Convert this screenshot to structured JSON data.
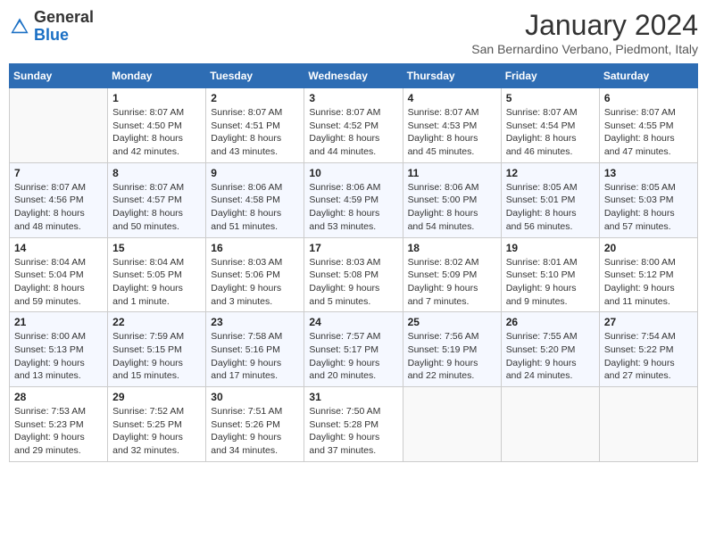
{
  "header": {
    "logo_general": "General",
    "logo_blue": "Blue",
    "title": "January 2024",
    "subtitle": "San Bernardino Verbano, Piedmont, Italy"
  },
  "weekdays": [
    "Sunday",
    "Monday",
    "Tuesday",
    "Wednesday",
    "Thursday",
    "Friday",
    "Saturday"
  ],
  "weeks": [
    [
      {
        "day": "",
        "sunrise": "",
        "sunset": "",
        "daylight": ""
      },
      {
        "day": "1",
        "sunrise": "Sunrise: 8:07 AM",
        "sunset": "Sunset: 4:50 PM",
        "daylight": "Daylight: 8 hours and 42 minutes."
      },
      {
        "day": "2",
        "sunrise": "Sunrise: 8:07 AM",
        "sunset": "Sunset: 4:51 PM",
        "daylight": "Daylight: 8 hours and 43 minutes."
      },
      {
        "day": "3",
        "sunrise": "Sunrise: 8:07 AM",
        "sunset": "Sunset: 4:52 PM",
        "daylight": "Daylight: 8 hours and 44 minutes."
      },
      {
        "day": "4",
        "sunrise": "Sunrise: 8:07 AM",
        "sunset": "Sunset: 4:53 PM",
        "daylight": "Daylight: 8 hours and 45 minutes."
      },
      {
        "day": "5",
        "sunrise": "Sunrise: 8:07 AM",
        "sunset": "Sunset: 4:54 PM",
        "daylight": "Daylight: 8 hours and 46 minutes."
      },
      {
        "day": "6",
        "sunrise": "Sunrise: 8:07 AM",
        "sunset": "Sunset: 4:55 PM",
        "daylight": "Daylight: 8 hours and 47 minutes."
      }
    ],
    [
      {
        "day": "7",
        "sunrise": "Sunrise: 8:07 AM",
        "sunset": "Sunset: 4:56 PM",
        "daylight": "Daylight: 8 hours and 48 minutes."
      },
      {
        "day": "8",
        "sunrise": "Sunrise: 8:07 AM",
        "sunset": "Sunset: 4:57 PM",
        "daylight": "Daylight: 8 hours and 50 minutes."
      },
      {
        "day": "9",
        "sunrise": "Sunrise: 8:06 AM",
        "sunset": "Sunset: 4:58 PM",
        "daylight": "Daylight: 8 hours and 51 minutes."
      },
      {
        "day": "10",
        "sunrise": "Sunrise: 8:06 AM",
        "sunset": "Sunset: 4:59 PM",
        "daylight": "Daylight: 8 hours and 53 minutes."
      },
      {
        "day": "11",
        "sunrise": "Sunrise: 8:06 AM",
        "sunset": "Sunset: 5:00 PM",
        "daylight": "Daylight: 8 hours and 54 minutes."
      },
      {
        "day": "12",
        "sunrise": "Sunrise: 8:05 AM",
        "sunset": "Sunset: 5:01 PM",
        "daylight": "Daylight: 8 hours and 56 minutes."
      },
      {
        "day": "13",
        "sunrise": "Sunrise: 8:05 AM",
        "sunset": "Sunset: 5:03 PM",
        "daylight": "Daylight: 8 hours and 57 minutes."
      }
    ],
    [
      {
        "day": "14",
        "sunrise": "Sunrise: 8:04 AM",
        "sunset": "Sunset: 5:04 PM",
        "daylight": "Daylight: 8 hours and 59 minutes."
      },
      {
        "day": "15",
        "sunrise": "Sunrise: 8:04 AM",
        "sunset": "Sunset: 5:05 PM",
        "daylight": "Daylight: 9 hours and 1 minute."
      },
      {
        "day": "16",
        "sunrise": "Sunrise: 8:03 AM",
        "sunset": "Sunset: 5:06 PM",
        "daylight": "Daylight: 9 hours and 3 minutes."
      },
      {
        "day": "17",
        "sunrise": "Sunrise: 8:03 AM",
        "sunset": "Sunset: 5:08 PM",
        "daylight": "Daylight: 9 hours and 5 minutes."
      },
      {
        "day": "18",
        "sunrise": "Sunrise: 8:02 AM",
        "sunset": "Sunset: 5:09 PM",
        "daylight": "Daylight: 9 hours and 7 minutes."
      },
      {
        "day": "19",
        "sunrise": "Sunrise: 8:01 AM",
        "sunset": "Sunset: 5:10 PM",
        "daylight": "Daylight: 9 hours and 9 minutes."
      },
      {
        "day": "20",
        "sunrise": "Sunrise: 8:00 AM",
        "sunset": "Sunset: 5:12 PM",
        "daylight": "Daylight: 9 hours and 11 minutes."
      }
    ],
    [
      {
        "day": "21",
        "sunrise": "Sunrise: 8:00 AM",
        "sunset": "Sunset: 5:13 PM",
        "daylight": "Daylight: 9 hours and 13 minutes."
      },
      {
        "day": "22",
        "sunrise": "Sunrise: 7:59 AM",
        "sunset": "Sunset: 5:15 PM",
        "daylight": "Daylight: 9 hours and 15 minutes."
      },
      {
        "day": "23",
        "sunrise": "Sunrise: 7:58 AM",
        "sunset": "Sunset: 5:16 PM",
        "daylight": "Daylight: 9 hours and 17 minutes."
      },
      {
        "day": "24",
        "sunrise": "Sunrise: 7:57 AM",
        "sunset": "Sunset: 5:17 PM",
        "daylight": "Daylight: 9 hours and 20 minutes."
      },
      {
        "day": "25",
        "sunrise": "Sunrise: 7:56 AM",
        "sunset": "Sunset: 5:19 PM",
        "daylight": "Daylight: 9 hours and 22 minutes."
      },
      {
        "day": "26",
        "sunrise": "Sunrise: 7:55 AM",
        "sunset": "Sunset: 5:20 PM",
        "daylight": "Daylight: 9 hours and 24 minutes."
      },
      {
        "day": "27",
        "sunrise": "Sunrise: 7:54 AM",
        "sunset": "Sunset: 5:22 PM",
        "daylight": "Daylight: 9 hours and 27 minutes."
      }
    ],
    [
      {
        "day": "28",
        "sunrise": "Sunrise: 7:53 AM",
        "sunset": "Sunset: 5:23 PM",
        "daylight": "Daylight: 9 hours and 29 minutes."
      },
      {
        "day": "29",
        "sunrise": "Sunrise: 7:52 AM",
        "sunset": "Sunset: 5:25 PM",
        "daylight": "Daylight: 9 hours and 32 minutes."
      },
      {
        "day": "30",
        "sunrise": "Sunrise: 7:51 AM",
        "sunset": "Sunset: 5:26 PM",
        "daylight": "Daylight: 9 hours and 34 minutes."
      },
      {
        "day": "31",
        "sunrise": "Sunrise: 7:50 AM",
        "sunset": "Sunset: 5:28 PM",
        "daylight": "Daylight: 9 hours and 37 minutes."
      },
      {
        "day": "",
        "sunrise": "",
        "sunset": "",
        "daylight": ""
      },
      {
        "day": "",
        "sunrise": "",
        "sunset": "",
        "daylight": ""
      },
      {
        "day": "",
        "sunrise": "",
        "sunset": "",
        "daylight": ""
      }
    ]
  ]
}
